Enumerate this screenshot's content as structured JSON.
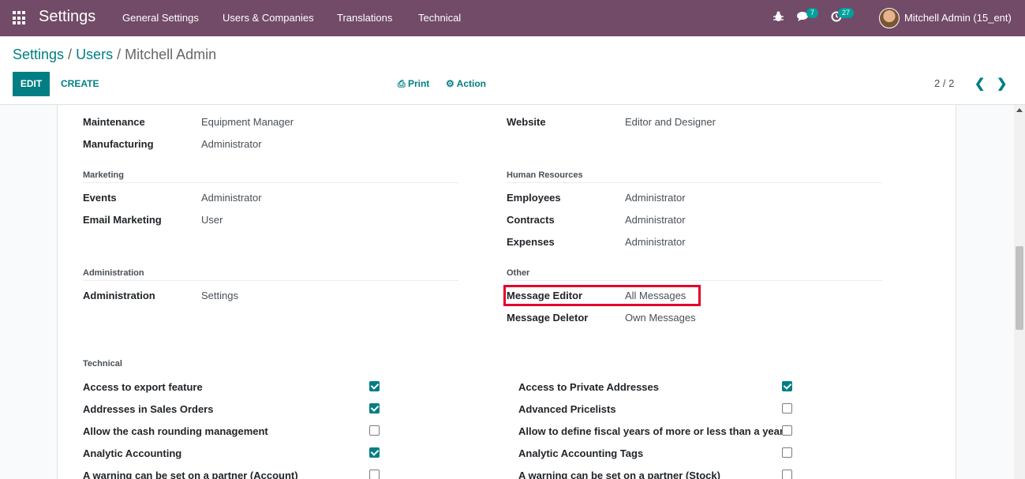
{
  "navbar": {
    "app_title": "Settings",
    "menus": [
      "General Settings",
      "Users & Companies",
      "Translations",
      "Technical"
    ],
    "messages_count": "7",
    "activities_count": "27",
    "user_name": "Mitchell Admin (15_ent)"
  },
  "breadcrumb": {
    "settings": "Settings",
    "users": "Users",
    "current": "Mitchell Admin"
  },
  "toolbar": {
    "edit": "EDIT",
    "create": "CREATE",
    "print": "Print",
    "action": "Action",
    "pager": "2 / 2"
  },
  "form": {
    "left_top": [
      {
        "label": "Maintenance",
        "value": "Equipment Manager"
      },
      {
        "label": "Manufacturing",
        "value": "Administrator"
      }
    ],
    "right_top": [
      {
        "label": "Website",
        "value": "Editor and Designer"
      }
    ],
    "marketing": {
      "title": "Marketing",
      "fields": [
        {
          "label": "Events",
          "value": "Administrator"
        },
        {
          "label": "Email Marketing",
          "value": "User"
        }
      ]
    },
    "human_resources": {
      "title": "Human Resources",
      "fields": [
        {
          "label": "Employees",
          "value": "Administrator"
        },
        {
          "label": "Contracts",
          "value": "Administrator"
        },
        {
          "label": "Expenses",
          "value": "Administrator"
        }
      ]
    },
    "administration": {
      "title": "Administration",
      "fields": [
        {
          "label": "Administration",
          "value": "Settings"
        }
      ]
    },
    "other": {
      "title": "Other",
      "fields": [
        {
          "label": "Message Editor",
          "value": "All Messages"
        },
        {
          "label": "Message Deletor",
          "value": "Own Messages"
        }
      ]
    },
    "technical": {
      "title": "Technical",
      "left": [
        {
          "label": "Access to export feature",
          "checked": true
        },
        {
          "label": "Addresses in Sales Orders",
          "checked": true
        },
        {
          "label": "Allow the cash rounding management",
          "checked": false
        },
        {
          "label": "Analytic Accounting",
          "checked": true
        },
        {
          "label": "A warning can be set on a partner (Account)",
          "checked": false
        }
      ],
      "right": [
        {
          "label": "Access to Private Addresses",
          "checked": true
        },
        {
          "label": "Advanced Pricelists",
          "checked": false
        },
        {
          "label": "Allow to define fiscal years of more or less than a year",
          "checked": false
        },
        {
          "label": "Analytic Accounting Tags",
          "checked": false
        },
        {
          "label": "A warning can be set on a partner (Stock)",
          "checked": false
        }
      ]
    }
  },
  "colors": {
    "navbar": "#714b67",
    "primary": "#017e84",
    "badge": "#00a09d",
    "highlight": "#e4002b"
  }
}
